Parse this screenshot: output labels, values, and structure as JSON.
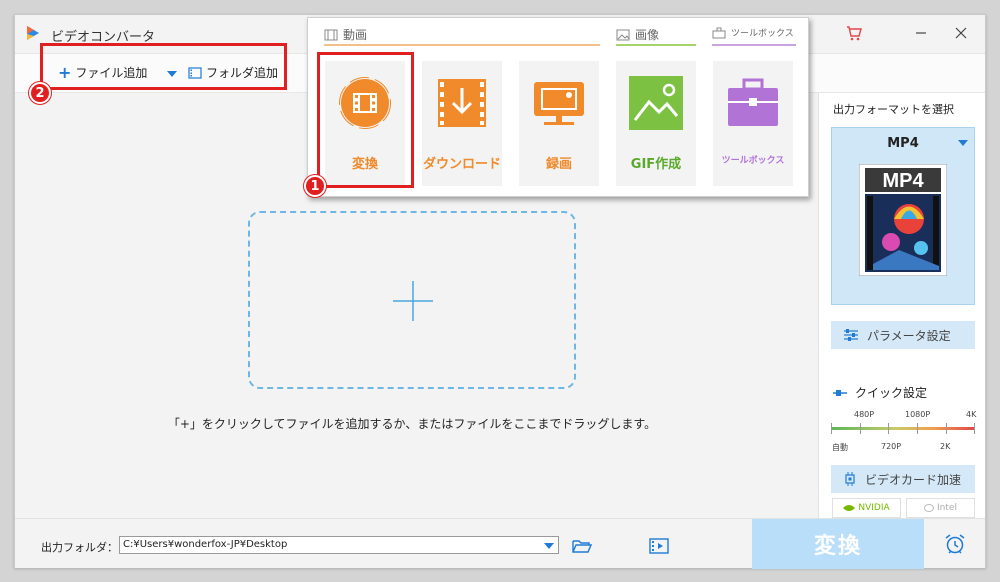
{
  "app": {
    "title": "ビデオコンバータ"
  },
  "toolbar": {
    "add_file_label": "ファイル追加",
    "add_folder_label": "フォルダ追加"
  },
  "annotations": {
    "badge_1": "1",
    "badge_2": "2"
  },
  "popup": {
    "sections": {
      "video": "動画",
      "image": "画像",
      "toolbox": "ツールボックス"
    },
    "functions": [
      {
        "label": "変換",
        "icon": "film-convert-icon"
      },
      {
        "label": "ダウンロード",
        "icon": "download-icon"
      },
      {
        "label": "録画",
        "icon": "screen-record-icon"
      },
      {
        "label": "GIF作成",
        "icon": "gif-image-icon"
      },
      {
        "label": "ツールボックス",
        "icon": "toolbox-icon"
      }
    ]
  },
  "main": {
    "drop_hint": "「+」をクリックしてファイルを追加するか、またはファイルをここまでドラッグします。"
  },
  "right_panel": {
    "title": "出力フォーマットを選択",
    "format": "MP4",
    "format_badge_text": "MP4",
    "param_button": "パラメータ設定",
    "quick_title": "クイック設定",
    "quality_top": [
      "480P",
      "1080P",
      "4K"
    ],
    "quality_bottom": [
      "自動",
      "720P",
      "2K"
    ],
    "gpu_button": "ビデオカード加速",
    "hw": [
      "NVIDIA",
      "Intel"
    ]
  },
  "bottom": {
    "output_label": "出力フォルダ：",
    "output_path": "C:¥Users¥wonderfox-JP¥Desktop",
    "convert_label": "変換"
  },
  "colors": {
    "accent": "#1f7bd6",
    "orange": "#f08a2b",
    "annotation_red": "#e02020",
    "convert_bg": "#b9defa"
  }
}
